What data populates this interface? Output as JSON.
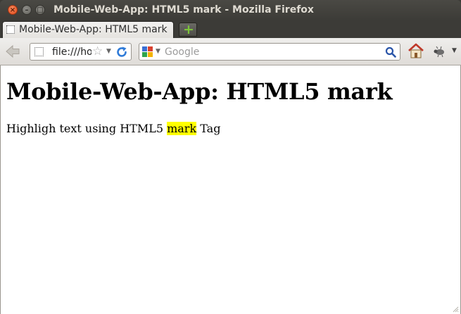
{
  "window": {
    "title": "Mobile-Web-App: HTML5 mark - Mozilla Firefox",
    "close_glyph": "×",
    "min_glyph": "–",
    "max_glyph": "□"
  },
  "tabs": [
    {
      "label": "Mobile-Web-App: HTML5 mark"
    }
  ],
  "new_tab_glyph": "+",
  "navbar": {
    "url": "file:///home/",
    "star_glyph": "☆",
    "dropdown_glyph": "▼",
    "search": {
      "value": "",
      "placeholder": "Google",
      "engine_icon": "google-icon"
    }
  },
  "page": {
    "heading": "Mobile-Web-App: HTML5 mark",
    "text_before": "Highligh text using HTML5 ",
    "text_mark": "mark",
    "text_after": " Tag"
  },
  "colors": {
    "mark_highlight": "#ffff00",
    "titlebar": "#3c3b37",
    "close_button": "#e24b1c",
    "newtab_plus": "#7cc43a"
  }
}
